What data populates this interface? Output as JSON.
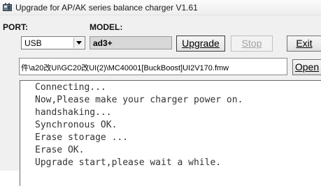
{
  "window": {
    "title": "Upgrade for AP/AK series balance charger V1.61",
    "icon": "charger-app-icon"
  },
  "labels": {
    "port": "PORT:",
    "model": "MODEL:"
  },
  "port_select": {
    "value": "USB"
  },
  "model_field": {
    "value": "ad3+"
  },
  "buttons": {
    "upgrade": "Upgrade",
    "stop": "Stop",
    "exit": "Exit",
    "open": "Open"
  },
  "file_path": {
    "value": "件\\a20改UI\\GC20改UI(2)\\MC40001[BuckBoost]UI2V170.fmw"
  },
  "log": {
    "lines": [
      "Connecting...",
      "Now,Please make your charger power on.",
      "handshaking...",
      "Synchronous OK.",
      "Erase storage ...",
      "Erase OK.",
      "Upgrade start,please wait a while."
    ]
  }
}
